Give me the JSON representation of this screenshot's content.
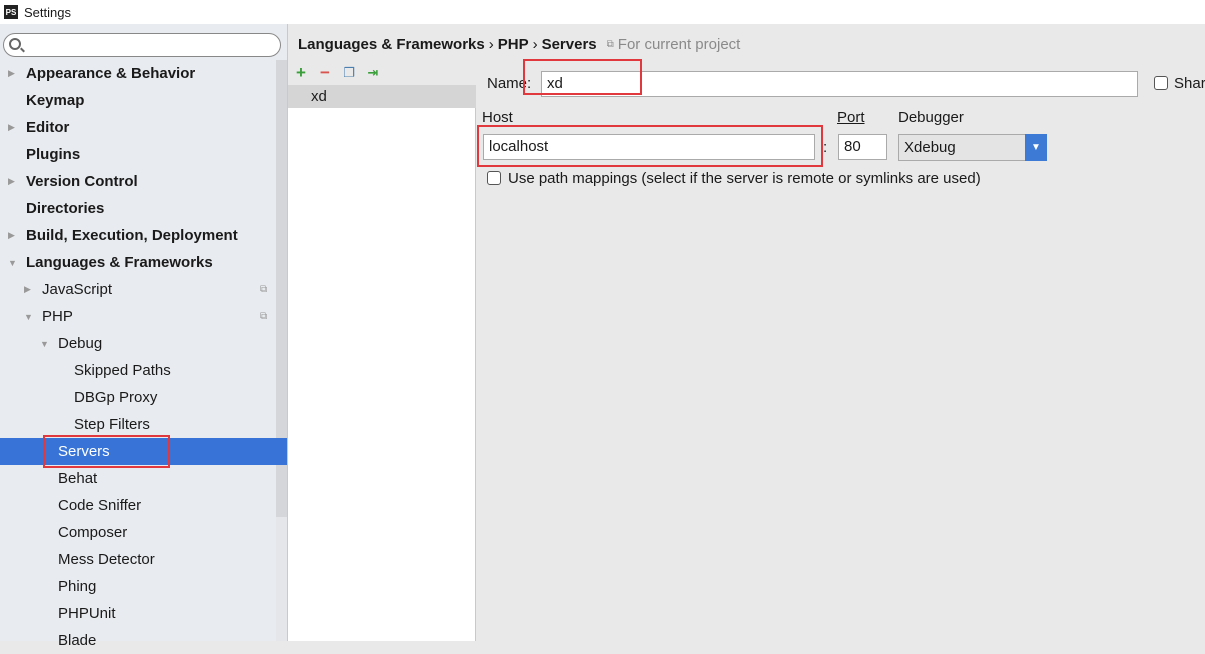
{
  "window": {
    "title": "Settings",
    "logo": "PS"
  },
  "sidebar": {
    "search_placeholder": "",
    "items": [
      {
        "label": "Appearance & Behavior",
        "level": 0,
        "bold": true,
        "arrow": "right"
      },
      {
        "label": "Keymap",
        "level": 0,
        "bold": true
      },
      {
        "label": "Editor",
        "level": 0,
        "bold": true,
        "arrow": "right"
      },
      {
        "label": "Plugins",
        "level": 0,
        "bold": true
      },
      {
        "label": "Version Control",
        "level": 0,
        "bold": true,
        "arrow": "right"
      },
      {
        "label": "Directories",
        "level": 0,
        "bold": true
      },
      {
        "label": "Build, Execution, Deployment",
        "level": 0,
        "bold": true,
        "arrow": "right"
      },
      {
        "label": "Languages & Frameworks",
        "level": 0,
        "bold": true,
        "arrow": "down"
      },
      {
        "label": "JavaScript",
        "level": 1,
        "arrow": "right",
        "project": true
      },
      {
        "label": "PHP",
        "level": 1,
        "arrow": "down",
        "project": true
      },
      {
        "label": "Debug",
        "level": 2,
        "arrow": "down"
      },
      {
        "label": "Skipped Paths",
        "level": 3
      },
      {
        "label": "DBGp Proxy",
        "level": 3
      },
      {
        "label": "Step Filters",
        "level": 3
      },
      {
        "label": "Servers",
        "level": 2,
        "selected": true
      },
      {
        "label": "Behat",
        "level": 2
      },
      {
        "label": "Code Sniffer",
        "level": 2
      },
      {
        "label": "Composer",
        "level": 2
      },
      {
        "label": "Mess Detector",
        "level": 2
      },
      {
        "label": "Phing",
        "level": 2
      },
      {
        "label": "PHPUnit",
        "level": 2
      },
      {
        "label": "Blade",
        "level": 2
      }
    ]
  },
  "breadcrumb": {
    "parts": [
      "Languages & Frameworks",
      "PHP",
      "Servers"
    ],
    "separator": "›",
    "scope": "For current project"
  },
  "servers": {
    "toolbar": [
      "add-icon",
      "remove-icon",
      "copy-icon",
      "import-icon"
    ],
    "items": [
      "xd"
    ]
  },
  "form": {
    "name_label": "Name:",
    "name_value": "xd",
    "share_label": "Shared",
    "host_label": "Host",
    "host_value": "localhost",
    "port_label": "Port",
    "port_value": "80",
    "colon": ":",
    "debugger_label": "Debugger",
    "debugger_value": "Xdebug",
    "path_mappings_label": "Use path mappings (select if the server is remote or symlinks are used)",
    "path_mappings_checked": false,
    "shared_checked": false
  },
  "colors": {
    "selection": "#3874d8",
    "highlight": "#e0383c",
    "add": "#3a9e3a",
    "remove": "#d9534f"
  }
}
